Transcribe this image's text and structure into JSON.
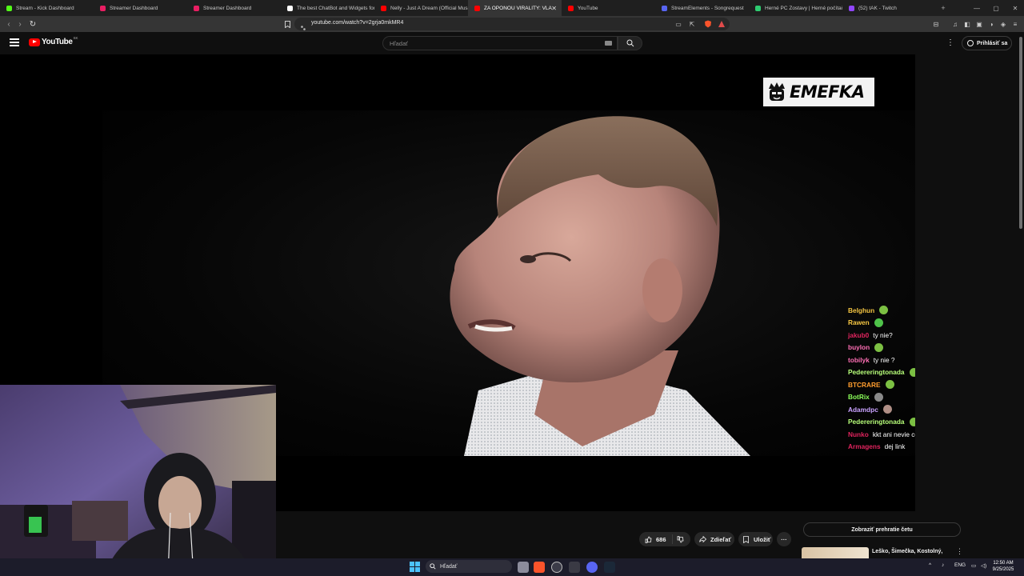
{
  "browser": {
    "tabs": [
      {
        "label": "Stream - Kick Dashboard",
        "favicon_color": "#53fc18",
        "active": false
      },
      {
        "label": "Streamer Dashboard",
        "favicon_color": "#e91e63",
        "active": false
      },
      {
        "label": "Streamer Dashboard",
        "favicon_color": "#e91e63",
        "active": false
      },
      {
        "label": "The best ChatBot and Widgets for",
        "favicon_color": "#ffffff",
        "active": false
      },
      {
        "label": "Nelly - Just A Dream (Official Musi",
        "favicon_color": "#ff0000",
        "active": false
      },
      {
        "label": "ZA OPONOU VIRALITY: VLA",
        "favicon_color": "#ff0000",
        "active": true
      },
      {
        "label": "YouTube",
        "favicon_color": "#ff0000",
        "active": false
      },
      {
        "label": "StreamElements - Songrequest",
        "favicon_color": "#5865f2",
        "active": false
      },
      {
        "label": "Herné PC Zostavy | Herné počítač",
        "favicon_color": "#2ecc71",
        "active": false
      },
      {
        "label": "(52) tAK - Twitch",
        "favicon_color": "#9146ff",
        "active": false
      }
    ],
    "new_tab_symbol": "+",
    "url": "youtube.com/watch?v=2grja0mkMR4",
    "shield_count": "0"
  },
  "youtube": {
    "logo_text": "YouTube",
    "country_code": "SK",
    "search_placeholder": "Hľadať",
    "sign_in_label": "Prihlásiť sa"
  },
  "video": {
    "watermark_text": "EMEFKA"
  },
  "chat_overlay": {
    "messages": [
      {
        "user": "Belghun",
        "color": "#f4c542",
        "text": "",
        "emote": "#7cc043"
      },
      {
        "user": "Rawen",
        "color": "#f4c542",
        "text": "",
        "emote": "#4fc34a"
      },
      {
        "user": "jakub0",
        "color": "#e0245e",
        "text": "ty nie?",
        "emote": ""
      },
      {
        "user": "buylon",
        "color": "#ff6fb5",
        "text": "",
        "emote": "#7cc043"
      },
      {
        "user": "tobilyk",
        "color": "#ff6fb5",
        "text": "ty nie ?",
        "emote": ""
      },
      {
        "user": "Pedereringtonada",
        "color": "#b8ff7a",
        "text": "",
        "emote": "#7cc043"
      },
      {
        "user": "BTCRARE",
        "color": "#ff9d2e",
        "text": "",
        "emote": "#7cc043"
      },
      {
        "user": "BotRix",
        "color": "#8cff5a",
        "text": "",
        "emote": "#8a8a8a"
      },
      {
        "user": "Adamdpc",
        "color": "#c9a2ff",
        "text": "",
        "emote": "#b08f86"
      },
      {
        "user": "Pedereringtonada",
        "color": "#b8ff7a",
        "text": "",
        "emote": "#7cc043"
      },
      {
        "user": "Nunko",
        "color": "#e0245e",
        "text": "kkt ani nevie co je to dabler :D",
        "emote": ""
      },
      {
        "user": "Armagens",
        "color": "#e0245e",
        "text": "dej link",
        "emote": ""
      }
    ]
  },
  "actions": {
    "like_count": "686",
    "share_label": "Zdieľať",
    "save_label": "Uložiť",
    "more_symbol": "···"
  },
  "sidebar": {
    "show_chat_replay": "Zobraziť prehratie četu",
    "recommended_title": "Leško, Šimečka, Kostolný,"
  },
  "taskbar": {
    "search_label": "Hľadať",
    "language": "ENG",
    "time": "12:50 AM",
    "date": "9/25/2025"
  }
}
